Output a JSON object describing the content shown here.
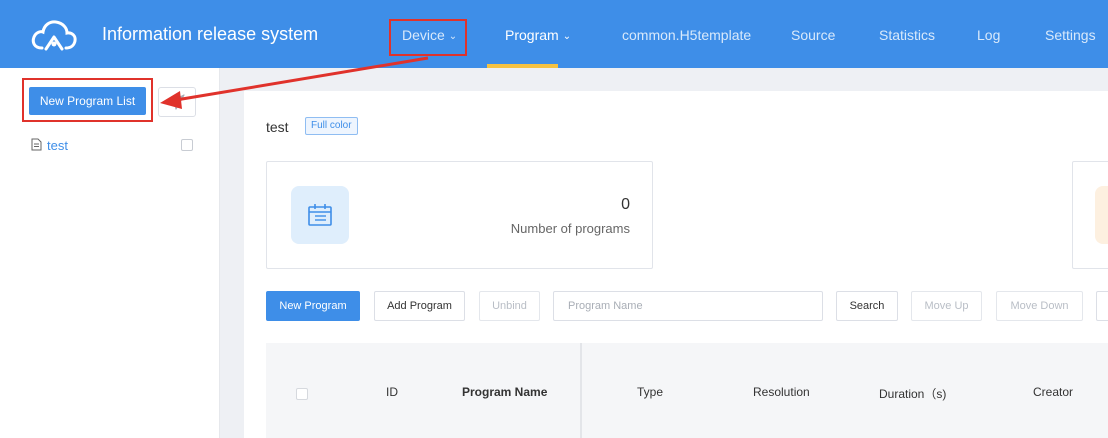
{
  "app": {
    "title": "Information release system",
    "nav": [
      {
        "label": "Device",
        "has_dropdown": true
      },
      {
        "label": "Program",
        "has_dropdown": true,
        "active": true
      },
      {
        "label": "common.H5template"
      },
      {
        "label": "Source"
      },
      {
        "label": "Statistics"
      },
      {
        "label": "Log"
      },
      {
        "label": "Settings"
      }
    ]
  },
  "sidebar": {
    "new_list_button": "New Program List",
    "send_icon": "paper-plane-icon",
    "items": [
      {
        "label": "test",
        "icon": "document-icon"
      }
    ]
  },
  "main": {
    "title": "test",
    "tag": "Full color",
    "stats": [
      {
        "value": "0",
        "label": "Number of programs",
        "icon": "calendar-icon"
      }
    ],
    "toolbar": {
      "new_program": "New Program",
      "add_program": "Add Program",
      "unbind": "Unbind",
      "search_placeholder": "Program Name",
      "search": "Search",
      "move_up": "Move Up",
      "move_down": "Move Down"
    },
    "table": {
      "columns": [
        "ID",
        "Program Name",
        "Type",
        "Resolution",
        "Duration（s)",
        "Creator"
      ]
    }
  },
  "colors": {
    "primary": "#3e8ee8",
    "nav_active_underline": "#f5c242",
    "annotation": "#e0322b"
  }
}
